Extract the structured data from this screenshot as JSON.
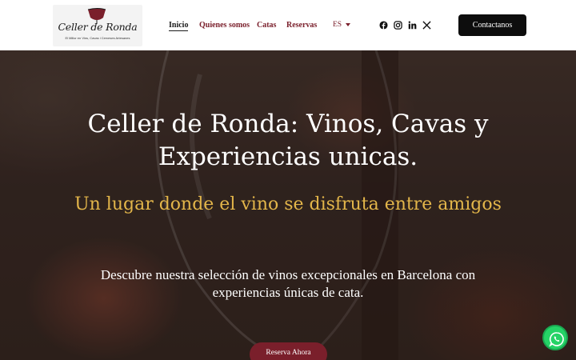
{
  "header": {
    "logo": {
      "name": "Celler de Ronda",
      "tagline": "El Millor en Vins, Cavas i Cerveses Artesanes"
    },
    "nav": [
      {
        "label": "Inicio",
        "active": true
      },
      {
        "label": "Quienes somos",
        "active": false
      },
      {
        "label": "Catas",
        "active": false
      },
      {
        "label": "Reservas",
        "active": false
      }
    ],
    "language": "ES",
    "social_icons": [
      "facebook-icon",
      "instagram-icon",
      "linkedin-icon",
      "x-icon"
    ],
    "contact_label": "Contactanos"
  },
  "hero": {
    "title_line1": "Celler de Ronda: Vinos, Cavas y",
    "title_line2": "Experiencias unicas.",
    "subtitle": "Un lugar donde el vino se disfruta entre amigos",
    "description_line1": "Descubre nuestra selección de vinos excepcionales en Barcelona con",
    "description_line2": "experiencias únicas de cata.",
    "button_label": "Reserva Ahora"
  },
  "floating": {
    "icon": "whatsapp-icon"
  },
  "colors": {
    "brand": "#7a1f2b",
    "accent_gold": "#e3b64a",
    "cta_black": "#0d0d0d",
    "whatsapp": "#25d366"
  }
}
